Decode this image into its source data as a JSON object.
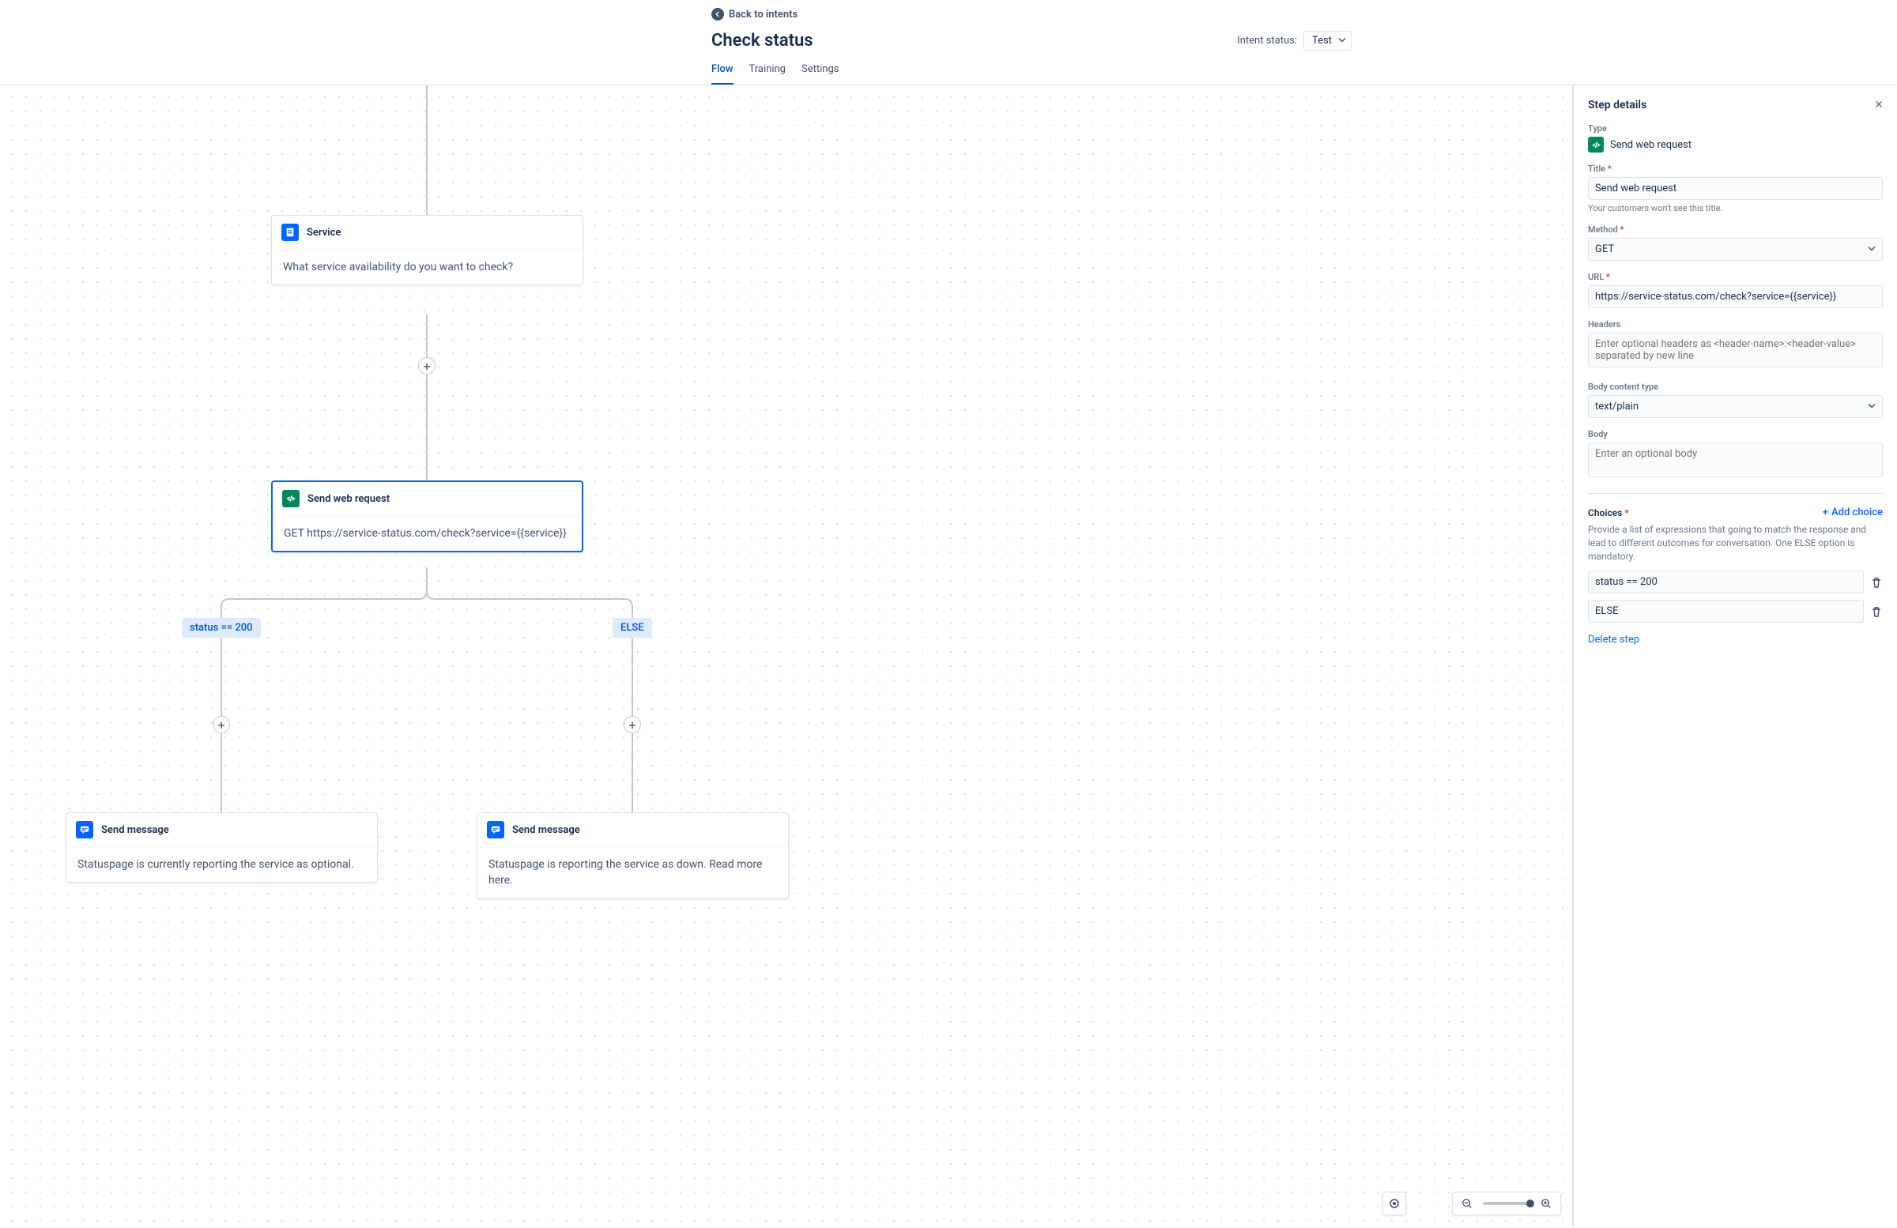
{
  "header": {
    "back_label": "Back to intents",
    "title": "Check status",
    "intent_status_label": "Intent status:",
    "intent_status_value": "Test",
    "tabs": {
      "flow": "Flow",
      "training": "Training",
      "settings": "Settings"
    }
  },
  "canvas": {
    "service_node": {
      "title": "Service",
      "body": "What service availability do you want to check?"
    },
    "webreq_node": {
      "title": "Send web request",
      "body": "GET https://service-status.com/check?service={{service}}"
    },
    "branch_left": "status == 200",
    "branch_right": "ELSE",
    "msg_left": {
      "title": "Send message",
      "body": "Statuspage is currently reporting the service as optional."
    },
    "msg_right": {
      "title": "Send message",
      "body": "Statuspage is reporting the service as down. Read more here."
    }
  },
  "panel": {
    "title": "Step details",
    "type_label": "Type",
    "type_value": "Send web request",
    "title_label": "Title",
    "title_value": "Send web request",
    "title_hint": "Your customers won't see this title.",
    "method_label": "Method",
    "method_value": "GET",
    "url_label": "URL",
    "url_value": "https://service-status.com/check?service={{service}}",
    "headers_label": "Headers",
    "headers_placeholder": "Enter optional headers as <header-name>:<header-value> separated by new line",
    "bodytype_label": "Body content type",
    "bodytype_value": "text/plain",
    "body_label": "Body",
    "body_placeholder": "Enter an optional body",
    "choices_label": "Choices",
    "add_choice": "Add choice",
    "choices_desc": "Provide a list of expressions that going to match the response and lead to different outcomes for conversation. One ELSE option is mandatory.",
    "choices": {
      "c0": "status == 200",
      "c1": "ELSE"
    },
    "delete_step": "Delete step"
  }
}
